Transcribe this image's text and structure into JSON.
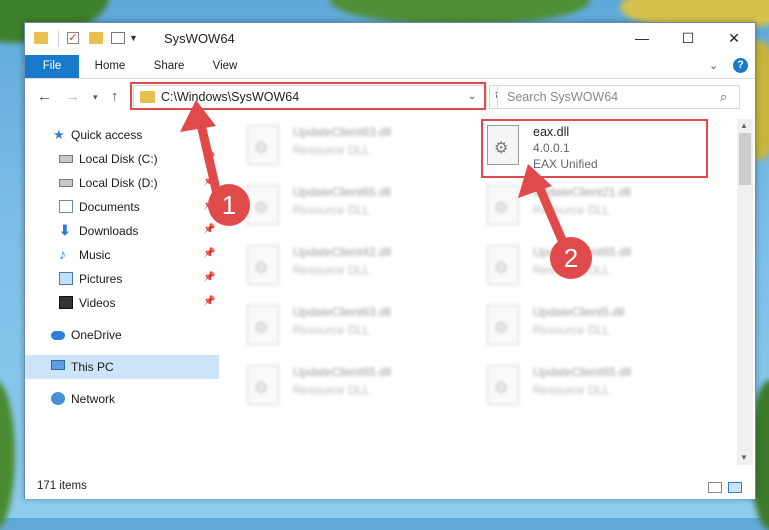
{
  "window": {
    "title": "SysWOW64",
    "controls": {
      "minimize": "—",
      "maximize": "☐",
      "close": "✕"
    }
  },
  "ribbon": {
    "tabs": [
      "File",
      "Home",
      "Share",
      "View"
    ]
  },
  "navigation": {
    "address": "C:\\Windows\\SysWOW64",
    "search_placeholder": "Search SysWOW64"
  },
  "sidebar": {
    "items": [
      {
        "label": "Quick access",
        "icon": "star-icon",
        "pinned": false
      },
      {
        "label": "Local Disk (C:)",
        "icon": "drive-icon",
        "pinned": true
      },
      {
        "label": "Local Disk (D:)",
        "icon": "drive-icon",
        "pinned": true
      },
      {
        "label": "Documents",
        "icon": "documents-icon",
        "pinned": true
      },
      {
        "label": "Downloads",
        "icon": "download-icon",
        "pinned": true
      },
      {
        "label": "Music",
        "icon": "music-icon",
        "pinned": true
      },
      {
        "label": "Pictures",
        "icon": "pictures-icon",
        "pinned": true
      },
      {
        "label": "Videos",
        "icon": "videos-icon",
        "pinned": true
      },
      {
        "label": "OneDrive",
        "icon": "cloud-icon",
        "pinned": false
      },
      {
        "label": "This PC",
        "icon": "computer-icon",
        "pinned": false,
        "selected": true
      },
      {
        "label": "Network",
        "icon": "network-icon",
        "pinned": false
      }
    ]
  },
  "files": {
    "highlighted": {
      "name": "eax.dll",
      "version": "4.0.0.1",
      "description": "EAX Unified"
    },
    "left_column": [
      {
        "name": "UpdateClient63.dll",
        "type": "Resource DLL"
      },
      {
        "name": "UpdateClient65.dll",
        "type": "Resource DLL"
      },
      {
        "name": "UpdateClient42.dll",
        "type": "Resource DLL"
      },
      {
        "name": "UpdateClient63.dll",
        "type": "Resource DLL"
      },
      {
        "name": "UpdateClient65.dll",
        "type": "Resource DLL"
      }
    ],
    "right_column": [
      {
        "name": "UpdateClient21.dll",
        "type": "Resource DLL"
      },
      {
        "name": "UpdateClient65.dll",
        "type": "Resource DLL"
      },
      {
        "name": "UpdateClient5.dll",
        "type": "Resource DLL"
      },
      {
        "name": "UpdateClient65.dll",
        "type": "Resource DLL"
      }
    ]
  },
  "status": {
    "item_count": "171 items"
  },
  "annotations": {
    "step1": "1",
    "step2": "2",
    "color": "#e04a4a"
  }
}
